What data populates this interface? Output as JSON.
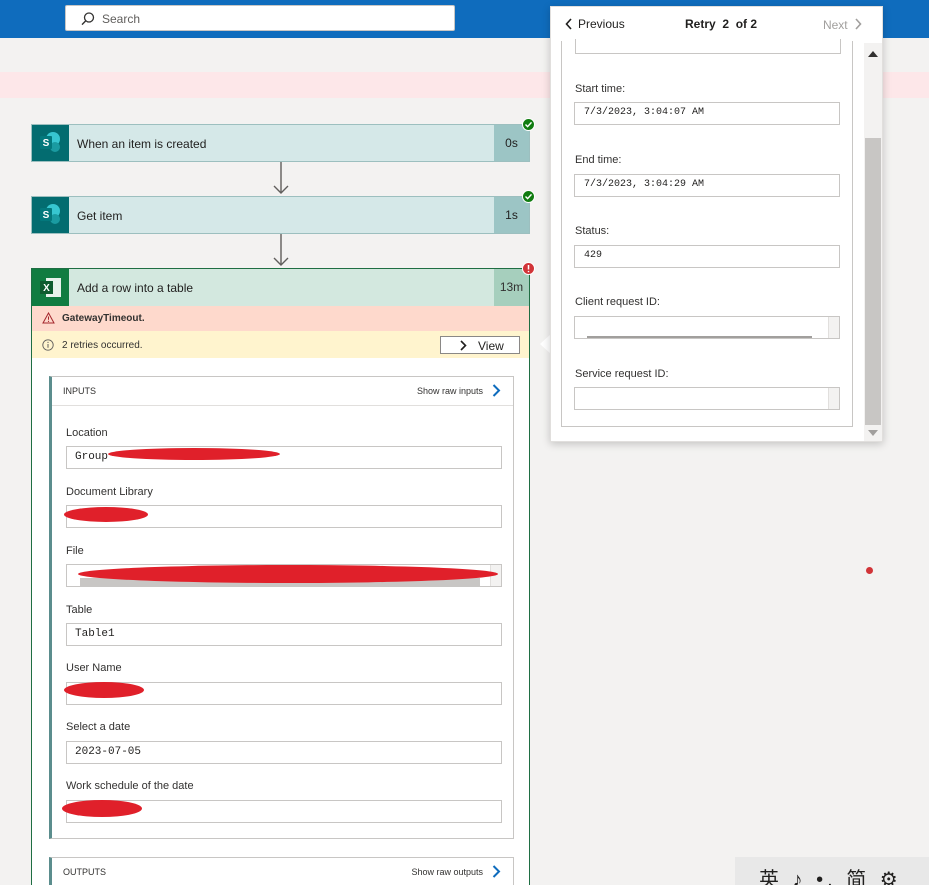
{
  "search": {
    "placeholder": "Search"
  },
  "flow": {
    "cards": [
      {
        "title": "When an item is created",
        "duration": "0s",
        "status": "success"
      },
      {
        "title": "Get item",
        "duration": "1s",
        "status": "success"
      }
    ],
    "excel_card": {
      "title": "Add a row into a table",
      "duration": "13m",
      "status": "error",
      "error_text": "GatewayTimeout.",
      "warning_text": "2 retries occurred.",
      "view_label": "View",
      "inputs": {
        "header": "INPUTS",
        "raw_link": "Show raw inputs",
        "fields": [
          {
            "label": "Location",
            "value": "Group -"
          },
          {
            "label": "Document Library",
            "value": ""
          },
          {
            "label": "File",
            "value": ""
          },
          {
            "label": "Table",
            "value": "Table1"
          },
          {
            "label": "User Name",
            "value": ""
          },
          {
            "label": "Select a date",
            "value": "2023-07-05"
          },
          {
            "label": "Work schedule of the date",
            "value": ""
          }
        ]
      },
      "outputs": {
        "header": "OUTPUTS",
        "raw_link": "Show raw outputs"
      }
    }
  },
  "retry_panel": {
    "previous_label": "Previous",
    "retry_label": "Retry",
    "retry_current": "2",
    "retry_total": "of 2",
    "next_label": "Next",
    "fields": [
      {
        "label": "Start time:",
        "value": "7/3/2023, 3:04:07 AM"
      },
      {
        "label": "End time:",
        "value": "7/3/2023, 3:04:29 AM"
      },
      {
        "label": "Status:",
        "value": "429"
      },
      {
        "label": "Client request ID:",
        "value": ""
      },
      {
        "label": "Service request ID:",
        "value": ""
      }
    ]
  },
  "ime_bar": {
    "text": "英 ♪ •, 简 ⚙"
  },
  "colors": {
    "topbar": "#0f6cbd",
    "sharepoint": "#036c70",
    "excel": "#107c41",
    "success": "#107c10",
    "error": "#d13438",
    "redaction": "#e0202a"
  }
}
